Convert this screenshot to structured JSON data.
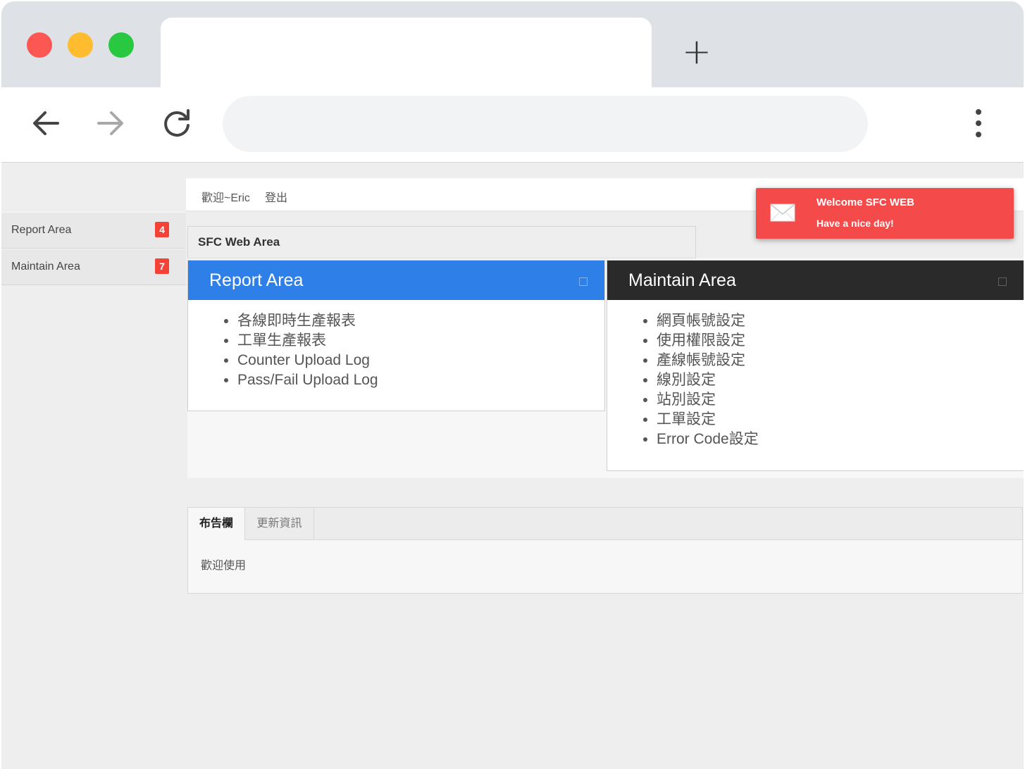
{
  "browser": {
    "new_tab_label": "+"
  },
  "sidebar": {
    "items": [
      {
        "label": "Report Area",
        "badge": "4"
      },
      {
        "label": "Maintain Area",
        "badge": "7"
      }
    ]
  },
  "topbar": {
    "welcome": "歡迎~Eric",
    "logout": "登出"
  },
  "toast": {
    "title": "Welcome SFC WEB",
    "message": "Have a nice day!",
    "color": "#f44a4a"
  },
  "section": {
    "title": "SFC Web Area"
  },
  "panels": {
    "report": {
      "title": "Report Area",
      "color": "#2f7fe8",
      "items": [
        "各線即時生產報表",
        "工單生產報表",
        "Counter Upload Log",
        "Pass/Fail Upload Log"
      ]
    },
    "maintain": {
      "title": "Maintain Area",
      "color": "#2a2a2a",
      "items": [
        "網頁帳號設定",
        "使用權限設定",
        "產線帳號設定",
        "線別設定",
        "站別設定",
        "工單設定",
        "Error Code設定"
      ]
    }
  },
  "tabs": {
    "items": [
      "布告欄",
      "更新資訊"
    ],
    "active": "布告欄",
    "body": "歡迎使用"
  }
}
